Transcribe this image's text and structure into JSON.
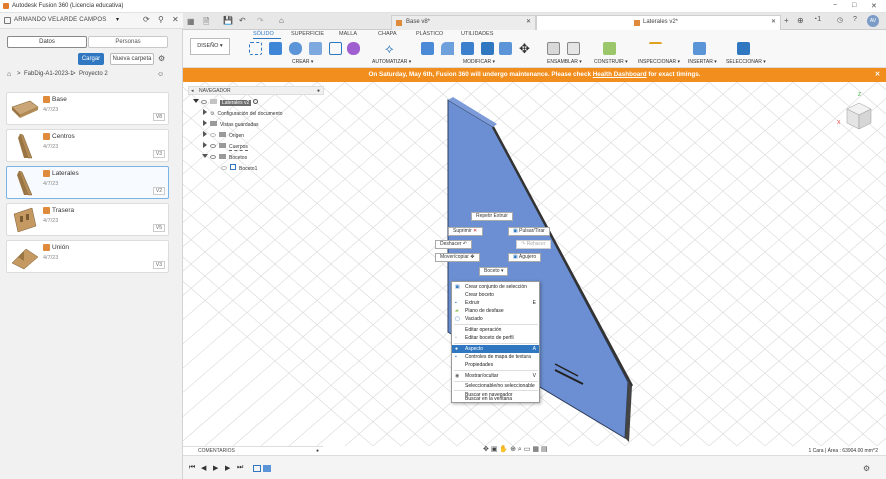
{
  "window": {
    "title": "Autodesk Fusion 360 (Licencia educativa)"
  },
  "user": {
    "name": "ARMANDO VELARDE CAMPOS"
  },
  "panel": {
    "tab_data": "Datos",
    "tab_people": "Personas",
    "upload": "Cargar",
    "new_folder": "Nueva carpeta",
    "breadcrumb_1": "FabDig-A1-2023-1",
    "breadcrumb_sep": ">",
    "breadcrumb_2": "Proyecto 2",
    "files": [
      {
        "name": "Base",
        "date": "4/7/23",
        "version": "V8"
      },
      {
        "name": "Centros",
        "date": "4/7/23",
        "version": "V3"
      },
      {
        "name": "Laterales",
        "date": "4/7/23",
        "version": "V2"
      },
      {
        "name": "Trasera",
        "date": "4/7/23",
        "version": "V5"
      },
      {
        "name": "Unión",
        "date": "4/7/23",
        "version": "V3"
      }
    ]
  },
  "doc_tabs": [
    {
      "label": "Base v8*"
    },
    {
      "label": "Laterales v2*"
    }
  ],
  "toolbar": {
    "workspace": "DISEÑO",
    "tabs": [
      "SÓLIDO",
      "SUPERFICIE",
      "MALLA",
      "CHAPA",
      "PLÁSTICO",
      "UTILIDADES"
    ],
    "groups": [
      "CREAR",
      "AUTOMATIZAR",
      "MODIFICAR",
      "ENSAMBLAR",
      "CONSTRUIR",
      "INSPECCIONAR",
      "INSERTAR",
      "SELECCIONAR"
    ]
  },
  "banner": {
    "text_before": "On Saturday, May 6th, Fusion 360 will undergo maintenance. Please check ",
    "link": "Health Dashboard",
    "text_after": " for exact timings."
  },
  "navigator": {
    "header": "NAVEGADOR",
    "root": "Laterales v2",
    "items": [
      "Configuración del documento",
      "Vistas guardadas",
      "Origen",
      "Cuerpos",
      "Bocetos",
      "Boceto1"
    ]
  },
  "marking": {
    "repeat": "Repetir Extruir",
    "delete": "Suprimir",
    "push_pull": "Pulsar/Tirar",
    "undo": "Deshacer",
    "redo": "Rehacer",
    "move": "Mover/copiar",
    "hole": "Agujero",
    "sketch": "Boceto"
  },
  "context_menu": {
    "items": [
      {
        "label": "Crear conjunto de selección"
      },
      {
        "label": "Crear boceto"
      },
      {
        "label": "Extruir",
        "shortcut": "E"
      },
      {
        "label": "Plano de desfase"
      },
      {
        "label": "Vaciado"
      },
      {
        "label": "Editar operación"
      },
      {
        "label": "Editar boceto de perfil"
      },
      {
        "label": "Aspecto",
        "shortcut": "A"
      },
      {
        "label": "Controles de mapa de textura"
      },
      {
        "label": "Propiedades"
      },
      {
        "label": "Mostrar/ocultar",
        "shortcut": "V"
      },
      {
        "label": "Seleccionable/no seleccionable"
      },
      {
        "label": "Buscar en navegador"
      },
      {
        "label": "Buscar en la ventana"
      }
    ]
  },
  "comments": "COMENTARIOS",
  "status": "1 Cara | Área : 63904.00 mm^2",
  "colors": {
    "accent": "#2f77c0",
    "banner": "#f28e1e",
    "part": "#6b8fd2"
  }
}
